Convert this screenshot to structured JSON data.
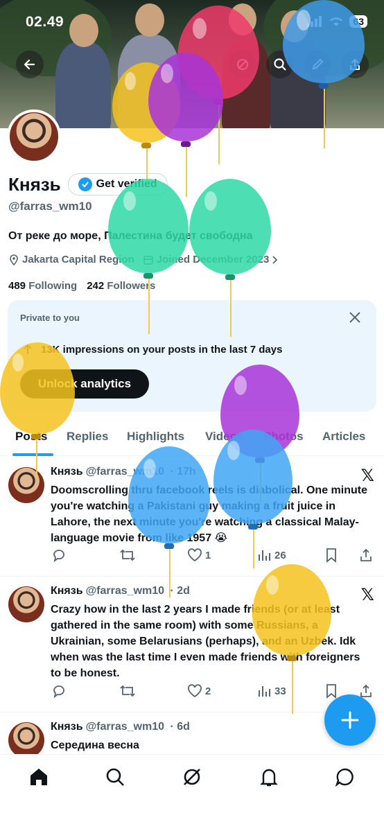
{
  "status_bar": {
    "time": "02.49",
    "battery": "63"
  },
  "profile": {
    "display_name": "Князь",
    "get_verified_label": "Get verified",
    "handle": "@farras_wm10",
    "bio": "От реке до море, Палестина будет свободна",
    "location": "Jakarta Capital Region",
    "joined": "Joined December 2023",
    "following_count": "489",
    "following_label": "Following",
    "followers_count": "242",
    "followers_label": "Followers"
  },
  "private_card": {
    "title": "Private to you",
    "impressions_text": "13K impressions on your posts in the last 7 days",
    "unlock_label": "Unlock analytics"
  },
  "tabs": [
    "Posts",
    "Replies",
    "Highlights",
    "Videos",
    "Photos",
    "Articles"
  ],
  "posts": [
    {
      "name": "Князь",
      "handle": "@farras_wm10",
      "time": "· 17h",
      "text": "Doomscrolling thru facebook reels is diabolical. One minute you're watching a Pakistani guy making a fruit juice in Lahore, the next minute you're watching a classical Malay-language movie from like 1957 😭",
      "likes": "1",
      "views": "26"
    },
    {
      "name": "Князь",
      "handle": "@farras_wm10",
      "time": "· 2d",
      "text": "Crazy how in the last 2 years I made friends (or at least gathered in the same room) with some Russians, a Ukrainian, some Belarusians (perhaps), and an Uzbek. Idk when was the last time I even made friends with foreigners to be honest.",
      "likes": "2",
      "views": "33"
    },
    {
      "name": "Князь",
      "handle": "@farras_wm10",
      "time": "· 6d",
      "text": "Середина весна"
    }
  ],
  "x_logo": "𝕏",
  "colors": {
    "accent": "#1d9bf0",
    "text": "#0f1419",
    "muted": "#536471",
    "card_bg": "#eaf5fd"
  },
  "icons": [
    "back-arrow-icon",
    "grok-icon",
    "search-icon",
    "edit-icon",
    "share-icon",
    "verified-badge-icon",
    "location-icon",
    "calendar-icon",
    "close-icon",
    "reply-icon",
    "repost-icon",
    "like-icon",
    "views-icon",
    "bookmark-icon",
    "home-icon",
    "explore-icon",
    "notifications-icon",
    "messages-icon",
    "compose-icon"
  ]
}
